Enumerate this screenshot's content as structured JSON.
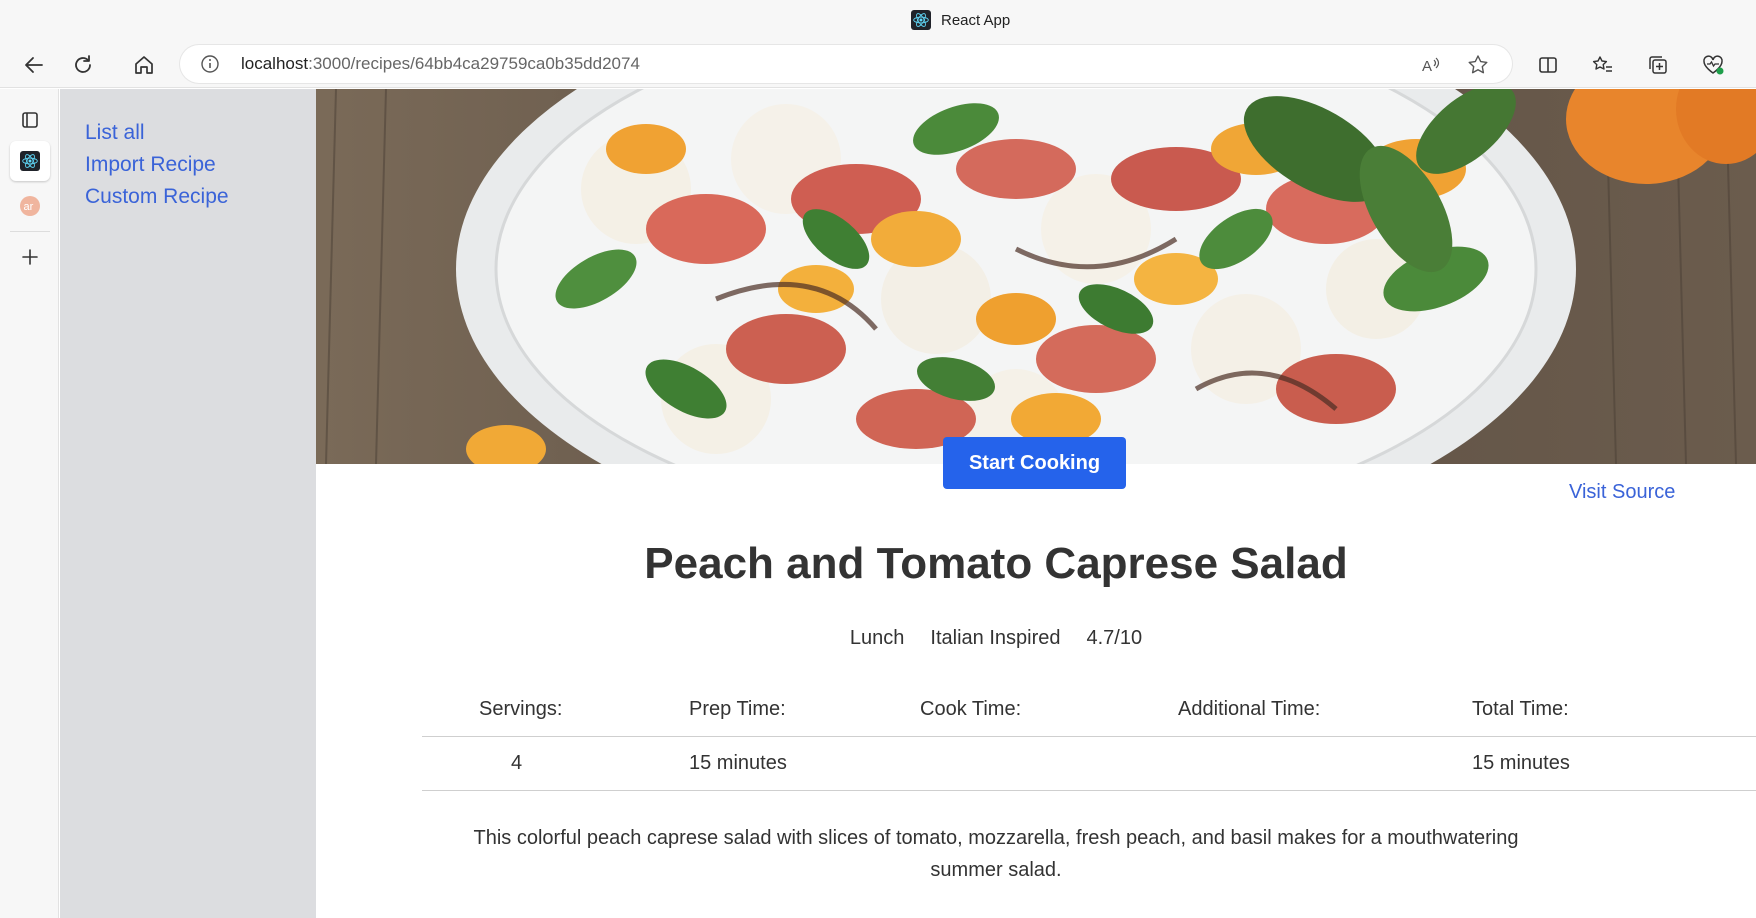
{
  "browser": {
    "tab_title": "React App",
    "url_host": "localhost",
    "url_path": ":3000/recipes/64bb4ca29759ca0b35dd2074"
  },
  "sidebar": {
    "links": [
      "List all",
      "Import Recipe",
      "Custom Recipe"
    ]
  },
  "recipe": {
    "start_button": "Start Cooking",
    "visit_source": "Visit Source",
    "title": "Peach and Tomato Caprese Salad",
    "meta": [
      "Lunch",
      "Italian Inspired",
      "4.7/10"
    ],
    "times_headers": [
      "Servings:",
      "Prep Time:",
      "Cook Time:",
      "Additional Time:",
      "Total Time:"
    ],
    "times_values": [
      "4",
      "15 minutes",
      "",
      "",
      "15 minutes"
    ],
    "description": "This colorful peach caprese salad with slices of tomato, mozzarella, fresh peach, and basil makes for a mouthwatering summer salad."
  },
  "colors": {
    "accent_button": "#2563eb",
    "link": "#3a63d8",
    "sidebar_bg": "#dcdde0"
  }
}
